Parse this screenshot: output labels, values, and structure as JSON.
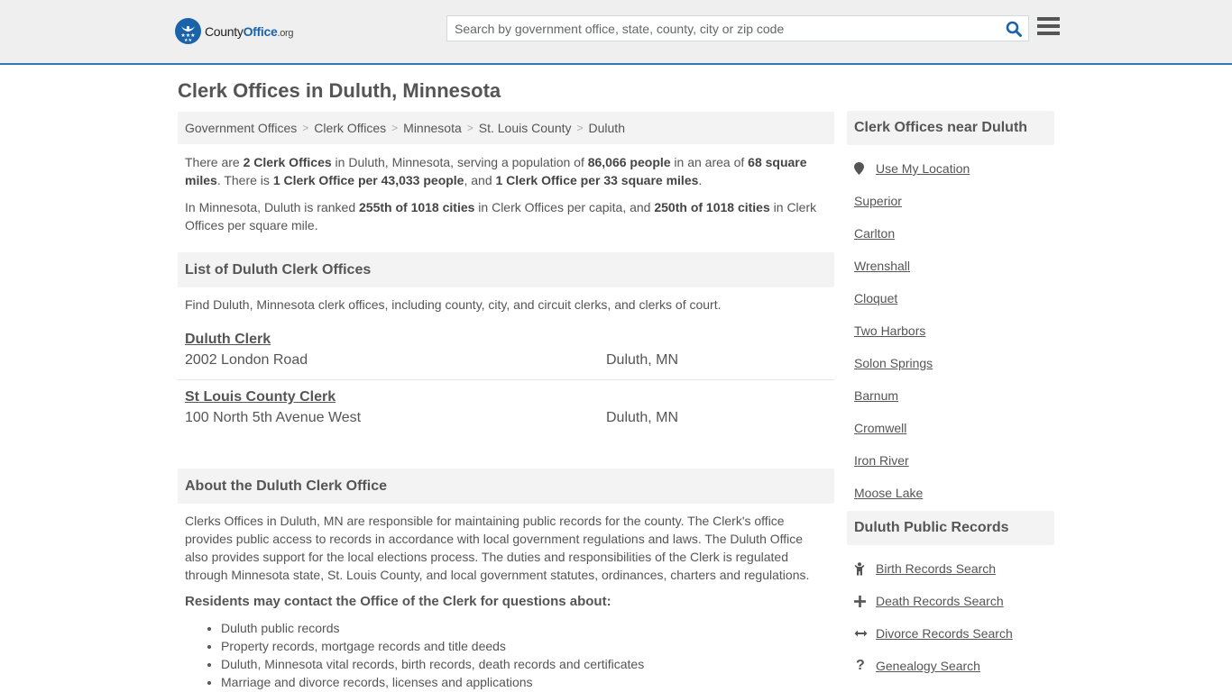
{
  "header": {
    "logo_main": "County",
    "logo_accent": "Office",
    "logo_tld": ".org",
    "search_placeholder": "Search by government office, state, county, city or zip code",
    "search_icon": "search-icon",
    "menu_icon": "hamburger-menu-icon",
    "accent_color": "#1a63a8"
  },
  "page": {
    "title": "Clerk Offices in Duluth, Minnesota"
  },
  "breadcrumb": [
    {
      "label": "Government Offices"
    },
    {
      "label": "Clerk Offices"
    },
    {
      "label": "Minnesota"
    },
    {
      "label": "St. Louis County"
    },
    {
      "label": "Duluth"
    }
  ],
  "summary": {
    "p1": {
      "t1": "There are ",
      "b1": "2 Clerk Offices",
      "t2": " in Duluth, Minnesota, serving a population of ",
      "b2": "86,066 people",
      "t3": " in an area of ",
      "b3": "68 square miles",
      "t4": ". There is ",
      "b4": "1 Clerk Office per 43,033 people",
      "t5": ", and ",
      "b5": "1 Clerk Office per 33 square miles",
      "t6": "."
    },
    "p2": {
      "t1": "In Minnesota, Duluth is ranked ",
      "b1": "255th of 1018 cities",
      "t2": " in Clerk Offices per capita, and ",
      "b2": "250th of 1018 cities",
      "t3": " in Clerk Offices per square mile."
    }
  },
  "list_section": {
    "heading": "List of Duluth Clerk Offices",
    "description": "Find Duluth, Minnesota clerk offices, including county, city, and circuit clerks, and clerks of court.",
    "offices": [
      {
        "name": "Duluth Clerk",
        "address": "2002 London Road",
        "city": "Duluth, MN"
      },
      {
        "name": "St Louis County Clerk",
        "address": "100 North 5th Avenue West",
        "city": "Duluth, MN"
      }
    ]
  },
  "about_section": {
    "heading": "About the Duluth Clerk Office",
    "text": "Clerks Offices in Duluth, MN are responsible for maintaining public records for the county. The Clerk's office provides public access to records in accordance with local government regulations and laws. The Duluth Office also provides support for the local elections process. The duties and responsibilities of the Clerk is regulated through Minnesota state, St. Louis County, and local government statutes, ordinances, charters and regulations.",
    "residents_heading": "Residents may contact the Office of the Clerk for questions about:",
    "residents_items": [
      "Duluth public records",
      "Property records, mortgage records and title deeds",
      "Duluth, Minnesota vital records, birth records, death records and certificates",
      "Marriage and divorce records, licenses and applications"
    ]
  },
  "sidebar": {
    "nearby_heading": "Clerk Offices near Duluth",
    "use_location": "Use My Location",
    "nearby": [
      "Superior",
      "Carlton",
      "Wrenshall",
      "Cloquet",
      "Two Harbors",
      "Solon Springs",
      "Barnum",
      "Cromwell",
      "Iron River",
      "Moose Lake"
    ],
    "records_heading": "Duluth Public Records",
    "records": [
      {
        "label": "Birth Records Search",
        "icon": "child-icon"
      },
      {
        "label": "Death Records Search",
        "icon": "cross-icon"
      },
      {
        "label": "Divorce Records Search",
        "icon": "arrows-horizontal-icon"
      },
      {
        "label": "Genealogy Search",
        "icon": "question-icon"
      }
    ]
  }
}
